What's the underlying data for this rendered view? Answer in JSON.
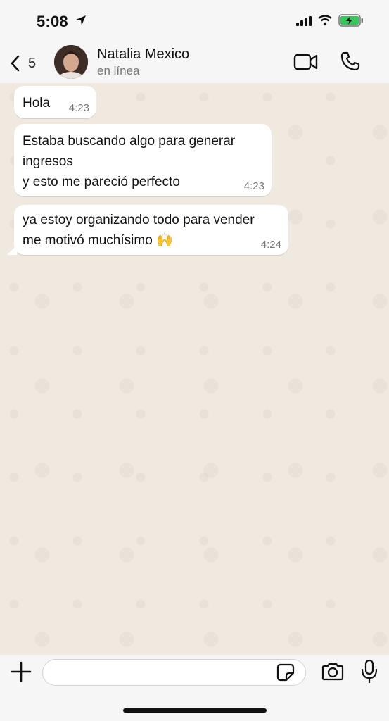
{
  "status_bar": {
    "time": "5:08",
    "battery_color": "#34c759"
  },
  "header": {
    "back_count": "5",
    "contact_name": "Natalia Mexico",
    "contact_status": "en línea"
  },
  "messages": [
    {
      "text_lines": [
        "Hola"
      ],
      "time": "4:23"
    },
    {
      "text_lines": [
        "Estaba buscando algo para generar",
        "ingresos",
        "y esto me pareció perfecto"
      ],
      "time": "4:23"
    },
    {
      "text_lines": [
        "ya estoy organizando todo para vender",
        "me motivó muchísimo 🙌"
      ],
      "time": "4:24"
    }
  ],
  "composer": {
    "value": "",
    "placeholder": ""
  },
  "colors": {
    "chat_background": "#efe9df",
    "bubble": "#ffffff",
    "bar": "#f6f6f6"
  }
}
